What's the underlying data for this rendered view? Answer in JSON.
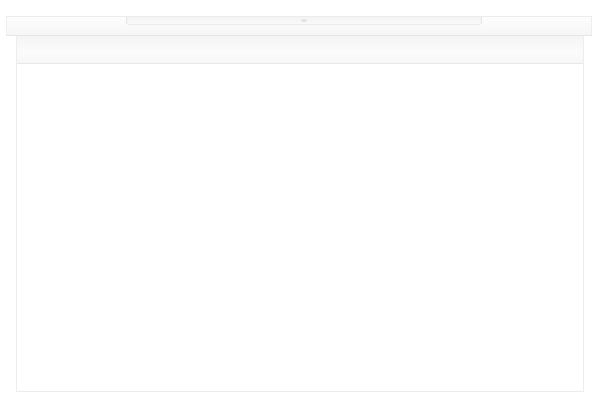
{
  "product": {
    "description_visible_text": "",
    "colors": {
      "background": "#ffffff",
      "cabinet": "#ffffff",
      "edge_shade": "#e8e8e8"
    },
    "icons": [
      "vanity-cabinet-icon"
    ]
  }
}
